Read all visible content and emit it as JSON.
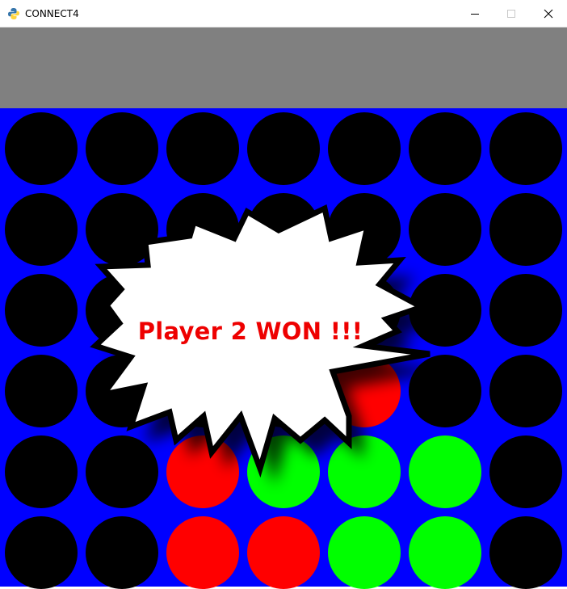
{
  "window": {
    "title": "CONNECT4",
    "icon": "python-icon",
    "controls": [
      "minimize-icon",
      "maximize-icon",
      "close-icon"
    ]
  },
  "colors": {
    "board": "#0000ff",
    "empty": "#000000",
    "player1": "#ff0000",
    "player2": "#00ff00",
    "topbar": "#808080",
    "banner_text": "#ee0000"
  },
  "board": {
    "rows": 6,
    "cols": 7,
    "cells": [
      [
        0,
        0,
        0,
        0,
        0,
        0,
        0
      ],
      [
        0,
        0,
        0,
        0,
        0,
        0,
        0
      ],
      [
        0,
        0,
        0,
        0,
        0,
        0,
        0
      ],
      [
        0,
        0,
        0,
        0,
        1,
        0,
        0
      ],
      [
        0,
        0,
        1,
        2,
        2,
        2,
        0
      ],
      [
        0,
        0,
        1,
        1,
        2,
        2,
        0
      ]
    ]
  },
  "result": {
    "message": "Player 2 WON !!!"
  }
}
